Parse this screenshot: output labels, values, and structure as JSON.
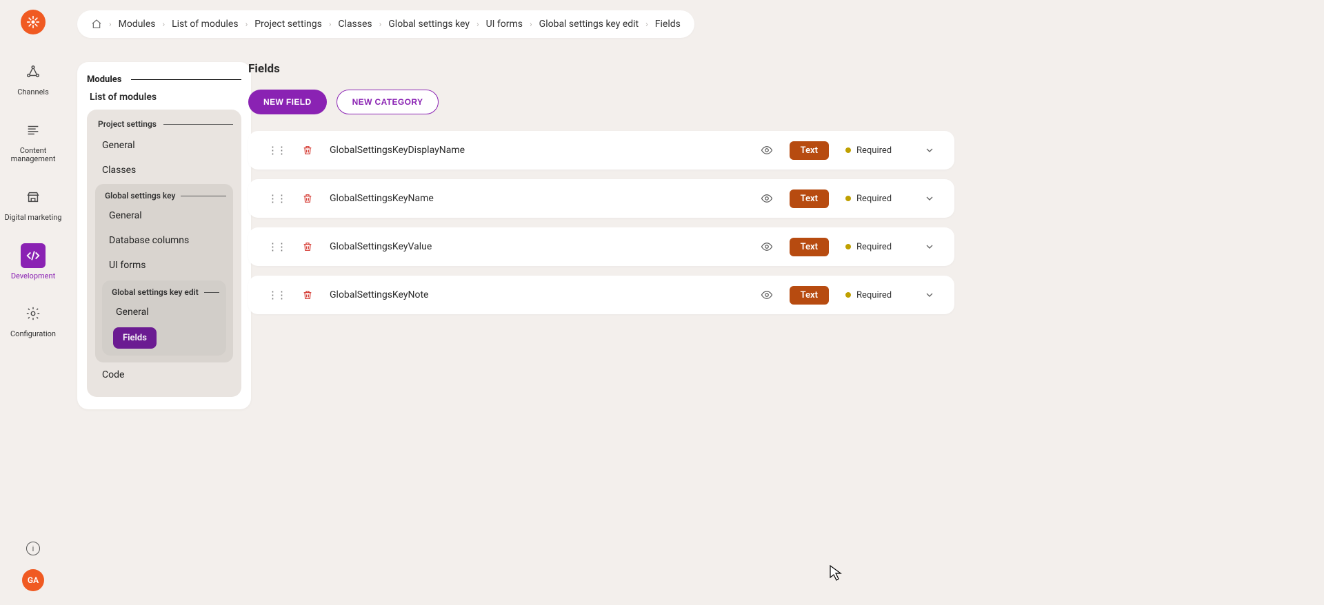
{
  "rail": {
    "items": [
      {
        "label": "Channels",
        "active": false
      },
      {
        "label": "Content management",
        "active": false
      },
      {
        "label": "Digital marketing",
        "active": false
      },
      {
        "label": "Development",
        "active": true
      },
      {
        "label": "Configuration",
        "active": false
      }
    ],
    "avatar": "GA"
  },
  "breadcrumbs": [
    "Modules",
    "List of modules",
    "Project settings",
    "Classes",
    "Global settings key",
    "UI forms",
    "Global settings key edit",
    "Fields"
  ],
  "side": {
    "root_label": "Modules",
    "root_sub": "List of modules",
    "project": {
      "label": "Project settings",
      "items": [
        "General",
        "Classes"
      ],
      "gs": {
        "label": "Global settings key",
        "items": [
          "General",
          "Database columns",
          "UI forms"
        ],
        "edit": {
          "label": "Global settings key edit",
          "general": "General",
          "fields": "Fields"
        }
      },
      "code": "Code"
    }
  },
  "main": {
    "title": "Fields",
    "new_field": "NEW FIELD",
    "new_category": "NEW CATEGORY",
    "rows": [
      {
        "name": "GlobalSettingsKeyDisplayName",
        "type": "Text",
        "required": "Required"
      },
      {
        "name": "GlobalSettingsKeyName",
        "type": "Text",
        "required": "Required"
      },
      {
        "name": "GlobalSettingsKeyValue",
        "type": "Text",
        "required": "Required"
      },
      {
        "name": "GlobalSettingsKeyNote",
        "type": "Text",
        "required": "Required"
      }
    ]
  }
}
